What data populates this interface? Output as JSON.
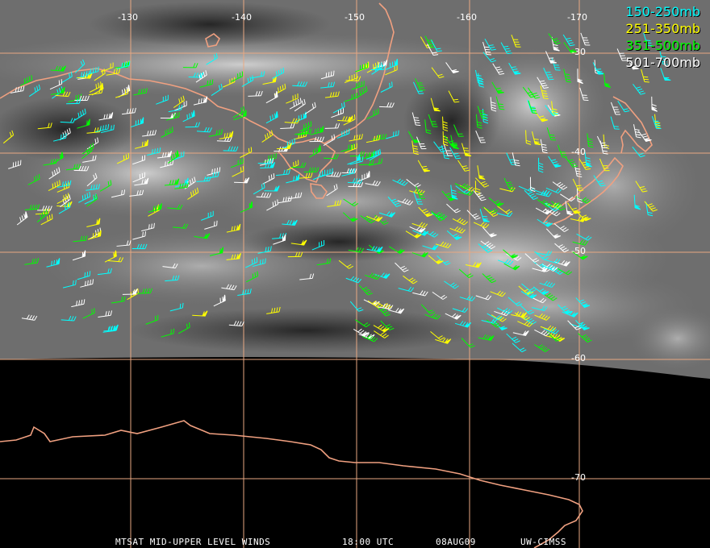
{
  "map": {
    "longitude_labels": [
      "-130",
      "-140",
      "-150",
      "-160",
      "-170"
    ],
    "latitude_labels": [
      "-30",
      "-40",
      "-50",
      "-60",
      "-70"
    ],
    "colors": {
      "grid": "#e8a882",
      "coastline": "#f0a080",
      "background_space": "#000000"
    }
  },
  "legend": [
    {
      "label": "150-250mb",
      "color": "#00ffff"
    },
    {
      "label": "251-350mb",
      "color": "#ffff00"
    },
    {
      "label": "351-500mb",
      "color": "#00ff00"
    },
    {
      "label": "501-700mb",
      "color": "#ffffff"
    }
  ],
  "footer": {
    "product": "MTSAT MID-UPPER LEVEL WINDS",
    "time": "18:00 UTC",
    "date": "08AUG09",
    "source": "UW-CIMSS"
  }
}
